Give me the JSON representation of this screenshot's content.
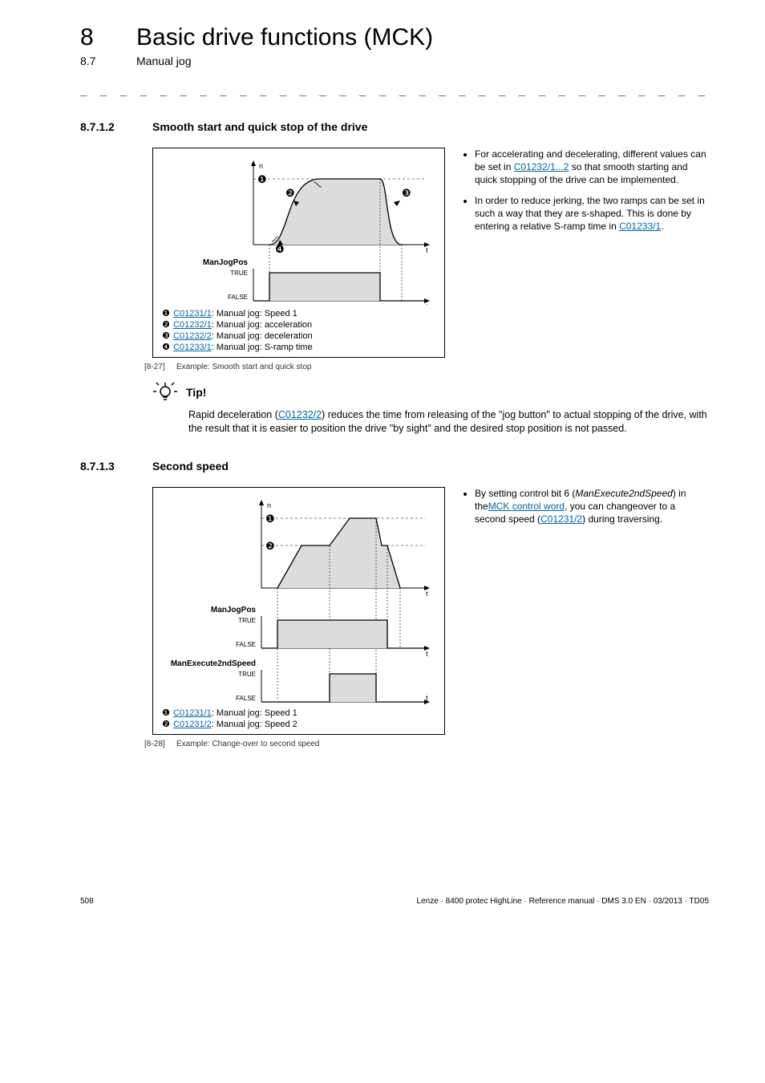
{
  "header": {
    "chapter_num": "8",
    "chapter_title": "Basic drive functions (MCK)",
    "section_num": "8.7",
    "section_title": "Manual jog"
  },
  "dashes": "_ _ _ _ _ _ _ _ _ _ _ _ _ _ _ _ _ _ _ _ _ _ _ _ _ _ _ _ _ _ _ _ _ _ _ _ _ _ _ _",
  "sec1": {
    "num": "8.7.1.2",
    "title": "Smooth start and quick stop of the drive",
    "legend": {
      "l1_code": "C01231/1",
      "l1_text": ": Manual jog: Speed 1",
      "l2_code": "C01232/1",
      "l2_text": ": Manual jog: acceleration",
      "l3_code": "C01232/2",
      "l3_text": ": Manual jog: deceleration",
      "l4_code": "C01233/1",
      "l4_text": ": Manual jog: S-ramp time"
    },
    "fig_num": "[8-27]",
    "fig_caption": "Example: Smooth start and quick stop",
    "chart_signals": {
      "name1": "ManJogPos",
      "true": "TRUE",
      "false": "FALSE",
      "axis_n": "n",
      "axis_t": "t"
    },
    "bullets": {
      "b1_a": "For accelerating and decelerating, different values can be set in ",
      "b1_link": "C01232/1...2",
      "b1_b": " so that smooth starting and quick stopping of the drive can be implemented.",
      "b2_a": "In order to reduce jerking, the two ramps can be set in such a way that they are s-shaped. This is done by entering a relative S-ramp time in ",
      "b2_link": "C01233/1",
      "b2_b": "."
    }
  },
  "tip": {
    "label": "Tip!",
    "t1": "Rapid deceleration (",
    "link": "C01232/2",
    "t2": ") reduces the time from releasing of the \"jog button\" to actual stopping of the drive, with the result that it is easier to position the drive \"by sight\" and the desired stop position is not passed."
  },
  "sec2": {
    "num": "8.7.1.3",
    "title": "Second speed",
    "legend": {
      "l1_code": "C01231/1",
      "l1_text": ": Manual jog: Speed 1",
      "l2_code": "C01231/2",
      "l2_text": ": Manual jog: Speed 2"
    },
    "fig_num": "[8-28]",
    "fig_caption": "Example: Change-over to second speed",
    "chart_signals": {
      "name1": "ManJogPos",
      "name2": "ManExecute2ndSpeed",
      "true": "TRUE",
      "false": "FALSE",
      "axis_n": "n",
      "axis_t": "t"
    },
    "bullets": {
      "b1_a": "By setting control bit 6 (",
      "b1_param": "ManExecute2ndSpeed",
      "b1_b": ") in the",
      "b1_link1": "MCK control word",
      "b1_c": ", you can changeover to a second speed (",
      "b1_link2": "C01231/2",
      "b1_d": ") during traversing."
    }
  },
  "footer": {
    "page": "508",
    "text": "Lenze · 8400 protec HighLine · Reference manual · DMS 3.0 EN · 03/2013 · TD05"
  }
}
